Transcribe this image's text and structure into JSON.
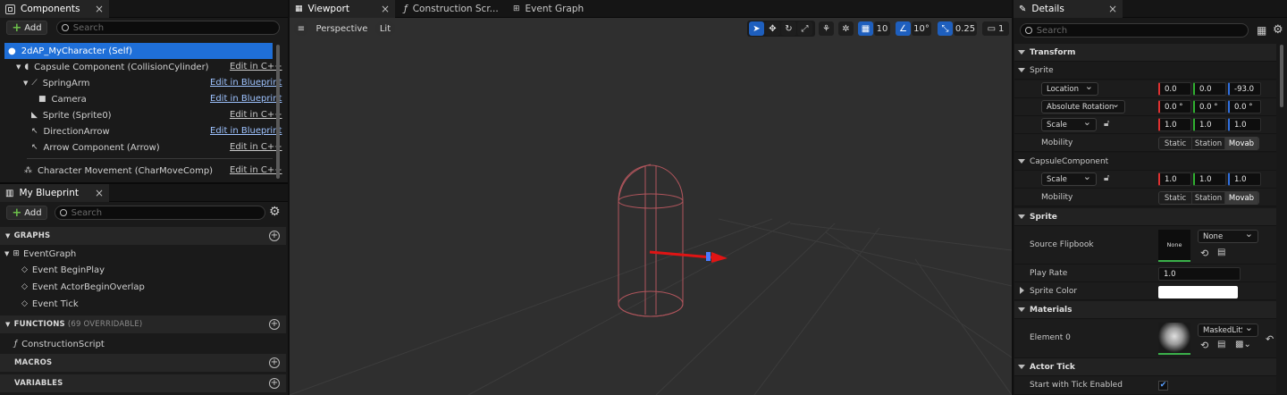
{
  "left_tab": {
    "title": "Components",
    "close": "×"
  },
  "components": {
    "add_label": "Add",
    "search_placeholder": "Search",
    "self_item": "2dAP_MyCharacter (Self)",
    "items": [
      {
        "label": "Capsule Component (CollisionCylinder)",
        "link": "Edit in C++"
      },
      {
        "label": "SpringArm",
        "link": "Edit in Blueprint"
      },
      {
        "label": "Camera",
        "link": "Edit in Blueprint"
      },
      {
        "label": "Sprite (Sprite0)",
        "link": "Edit in C++"
      },
      {
        "label": "DirectionArrow",
        "link": "Edit in Blueprint"
      },
      {
        "label": "Arrow Component (Arrow)",
        "link": "Edit in C++"
      },
      {
        "label": "Character Movement (CharMoveComp)",
        "link": "Edit in C++"
      }
    ]
  },
  "blueprint_tab": {
    "title": "My Blueprint",
    "close": "×"
  },
  "my_blueprint": {
    "add_label": "Add",
    "search_placeholder": "Search",
    "graphs_label": "GRAPHS",
    "event_graph": "EventGraph",
    "events": [
      "Event BeginPlay",
      "Event ActorBeginOverlap",
      "Event Tick"
    ],
    "functions_label": "FUNCTIONS",
    "functions_count": "(69 OVERRIDABLE)",
    "construction_script": "ConstructionScript",
    "macros_label": "MACROS",
    "variables_label": "VARIABLES"
  },
  "center_tabs": [
    {
      "label": "Viewport",
      "close": "×"
    },
    {
      "label": "Construction Scr..."
    },
    {
      "label": "Event Graph"
    }
  ],
  "viewport": {
    "perspective": "Perspective",
    "lit": "Lit",
    "grid_snap": "10",
    "rotation_snap": "10°",
    "scale_snap": "0.25",
    "camera_speed": "1"
  },
  "details": {
    "tab_title": "Details",
    "close": "×",
    "search_placeholder": "Search",
    "transform_label": "Transform",
    "sprite_group": "Sprite",
    "location_label": "Location",
    "location": [
      "0.0",
      "0.0",
      "-93.0"
    ],
    "rotation_label": "Absolute Rotation",
    "rotation": [
      "0.0 °",
      "0.0 °",
      "0.0 °"
    ],
    "scale_label": "Scale",
    "scale": [
      "1.0",
      "1.0",
      "1.0"
    ],
    "mobility_label": "Mobility",
    "mobility_options": [
      "Static",
      "Station",
      "Movab"
    ],
    "capsule_group": "CapsuleComponent",
    "capsule_scale_label": "Scale",
    "capsule_scale": [
      "1.0",
      "1.0",
      "1.0"
    ],
    "capsule_mobility_label": "Mobility",
    "sprite_section": "Sprite",
    "source_flipbook_label": "Source Flipbook",
    "flipbook_thumb": "None",
    "flipbook_value": "None",
    "play_rate_label": "Play Rate",
    "play_rate": "1.0",
    "sprite_color_label": "Sprite Color",
    "materials_section": "Materials",
    "element0_label": "Element 0",
    "element0_value": "MaskedLitS",
    "actor_tick_section": "Actor Tick",
    "start_tick_label": "Start with Tick Enabled"
  },
  "colors": {
    "accent": "#1e6ee0",
    "capsule": "#b0555c",
    "arrow": "#e01414"
  }
}
